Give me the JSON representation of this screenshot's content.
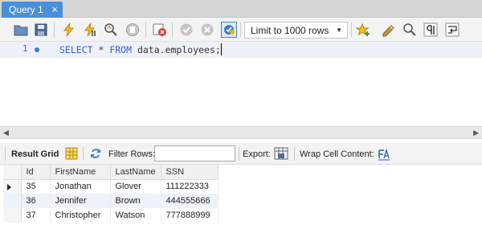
{
  "tab": {
    "title": "Query 1",
    "close_glyph": "×"
  },
  "toolbar": {
    "icons": [
      "open-folder-icon",
      "save-icon",
      "execute-icon",
      "execute-current-icon",
      "explain-icon",
      "stop-icon",
      "toggle-error-icon",
      "commit-icon",
      "rollback-icon",
      "autocommit-icon",
      "bookmark-star-icon",
      "beautify-icon",
      "find-icon",
      "invisible-chars-icon",
      "wrap-icon"
    ],
    "limit_select": "Limit to 1000 rows"
  },
  "editor": {
    "line_number": "1",
    "sql_keyword1": "SELECT",
    "sql_rest1": " * ",
    "sql_keyword2": "FROM",
    "sql_rest2": " data.employees;"
  },
  "result_toolbar": {
    "result_grid_label": "Result Grid",
    "filter_label": "Filter Rows:",
    "filter_value": "",
    "export_label": "Export:",
    "wrap_label": "Wrap Cell Content:"
  },
  "grid": {
    "columns": [
      "Id",
      "FirstName",
      "LastName",
      "SSN"
    ],
    "rows": [
      [
        "35",
        "Jonathan",
        "Glover",
        "111222333"
      ],
      [
        "36",
        "Jennifer",
        "Brown",
        "444555666"
      ],
      [
        "37",
        "Christopher",
        "Watson",
        "777888999"
      ]
    ]
  },
  "colors": {
    "tab_active": "#4a8fd8",
    "keyword": "#2c62c9",
    "editor_bg": "#eef0f7"
  }
}
